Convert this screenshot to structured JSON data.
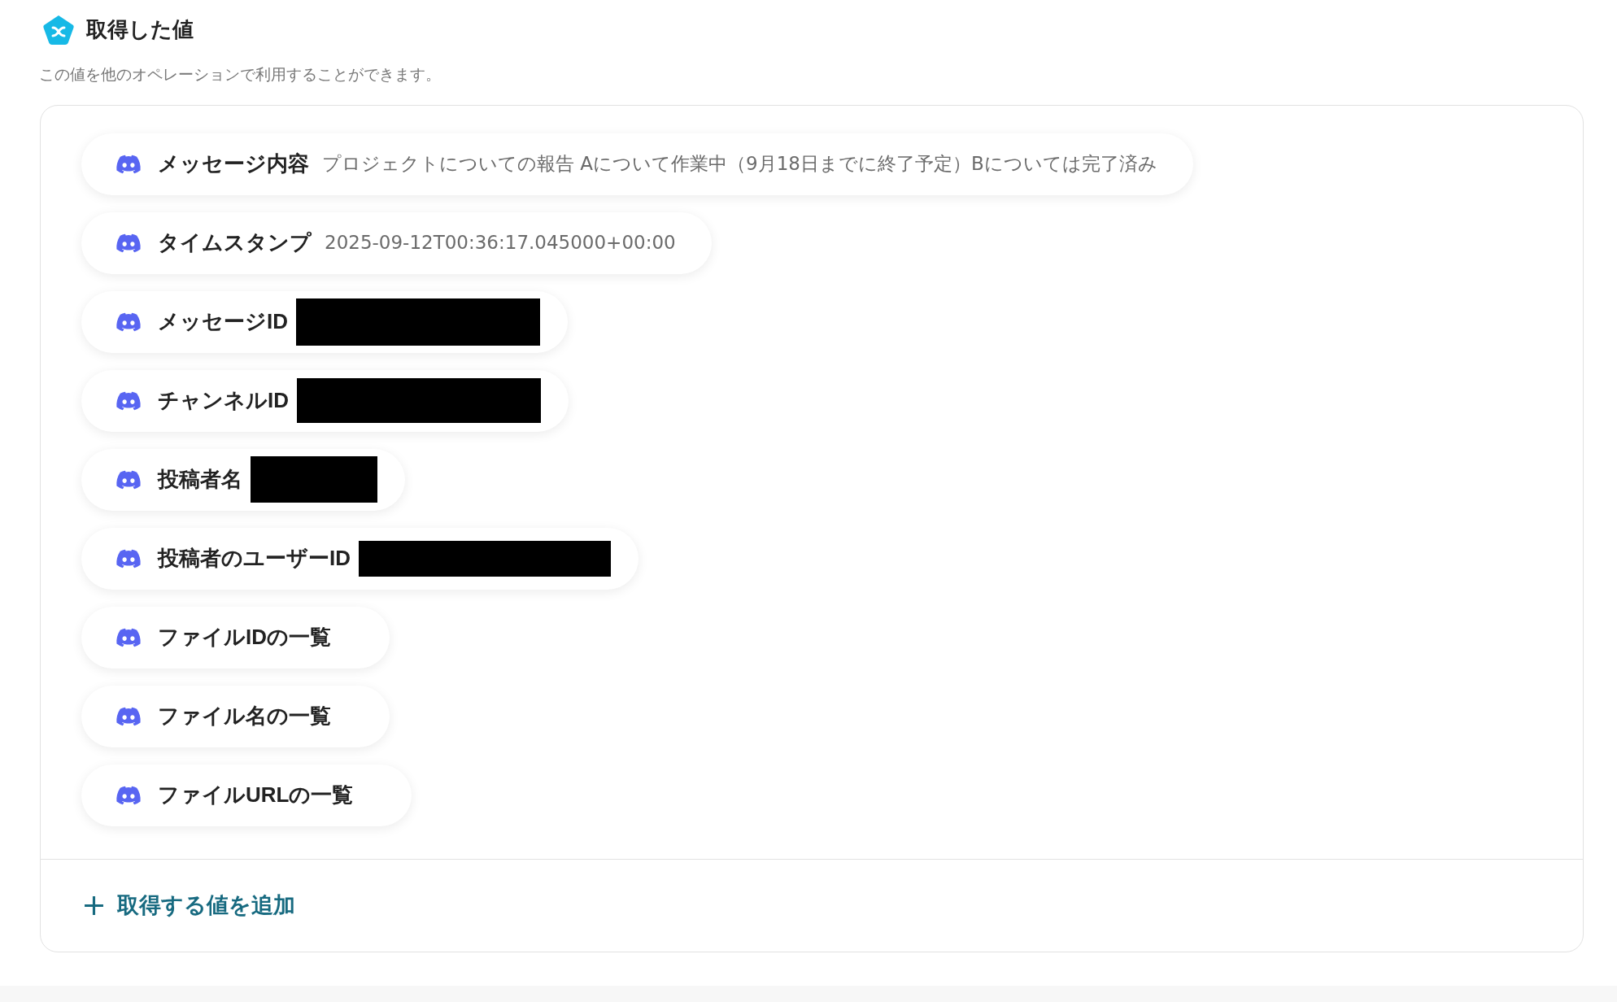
{
  "header": {
    "title": "取得した値",
    "description": "この値を他のオペレーションで利用することができます。"
  },
  "values": [
    {
      "label": "メッセージ内容",
      "kind": "text",
      "value": "プロジェクトについての報告 Aについて作業中（9月18日までに終了予定）Bについては完了済み"
    },
    {
      "label": "タイムスタンプ",
      "kind": "text",
      "value": "2025-09-12T00:36:17.045000+00:00"
    },
    {
      "label": "メッセージID",
      "kind": "redacted"
    },
    {
      "label": "チャンネルID",
      "kind": "redacted"
    },
    {
      "label": "投稿者名",
      "kind": "redacted"
    },
    {
      "label": "投稿者のユーザーID",
      "kind": "redacted"
    },
    {
      "label": "ファイルIDの一覧",
      "kind": "empty"
    },
    {
      "label": "ファイル名の一覧",
      "kind": "empty"
    },
    {
      "label": "ファイルURLの一覧",
      "kind": "empty"
    }
  ],
  "add_button": {
    "label": "取得する値を追加"
  }
}
